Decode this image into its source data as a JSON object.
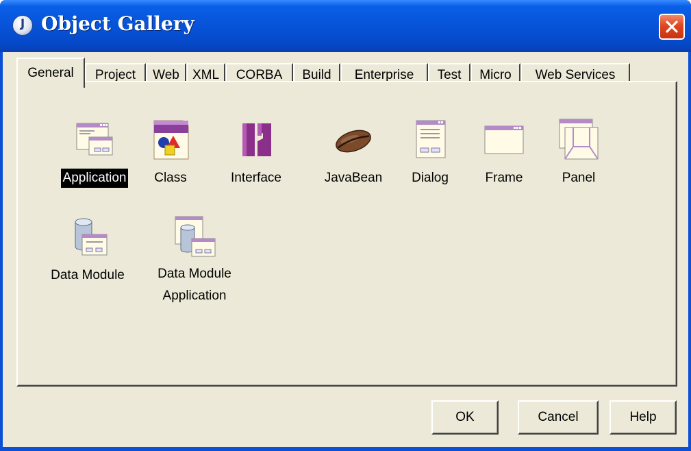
{
  "window": {
    "title": "Object Gallery"
  },
  "tabs": [
    {
      "label": "General",
      "active": true
    },
    {
      "label": "Project"
    },
    {
      "label": "Web"
    },
    {
      "label": "XML"
    },
    {
      "label": "CORBA"
    },
    {
      "label": "Build"
    },
    {
      "label": "Enterprise"
    },
    {
      "label": "Test"
    },
    {
      "label": "Micro"
    },
    {
      "label": "Web Services"
    }
  ],
  "gallery": {
    "items": [
      {
        "label": "Application",
        "icon": "application-icon",
        "selected": true
      },
      {
        "label": "Class",
        "icon": "class-icon"
      },
      {
        "label": "Interface",
        "icon": "interface-icon"
      },
      {
        "label": "JavaBean",
        "icon": "javabean-icon"
      },
      {
        "label": "Dialog",
        "icon": "dialog-icon"
      },
      {
        "label": "Frame",
        "icon": "frame-icon"
      },
      {
        "label": "Panel",
        "icon": "panel-icon"
      },
      {
        "label": "Data Module",
        "icon": "data-module-icon"
      },
      {
        "label_line1": "Data Module",
        "label_line2": "Application",
        "icon": "data-module-application-icon"
      }
    ]
  },
  "buttons": {
    "ok": "OK",
    "cancel": "Cancel",
    "help": "Help"
  },
  "colors": {
    "titlebar": "#0753d8",
    "client": "#ece9d8",
    "selection": "#000000",
    "close": "#e0461f"
  }
}
